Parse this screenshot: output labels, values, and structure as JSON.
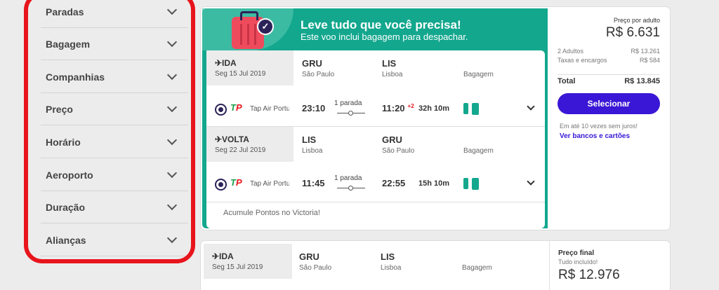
{
  "filters": {
    "items": [
      "Paradas",
      "Bagagem",
      "Companhias",
      "Preço",
      "Horário",
      "Aeroporto",
      "Duração",
      "Alianças"
    ]
  },
  "colors": {
    "accent": "#3a17d6",
    "promo": "#13a78e",
    "highlight_frame": "#e8141c"
  },
  "offer": {
    "promo_title": "Leve tudo que você precisa!",
    "promo_subtitle": "Este voo inclui bagagem para despachar.",
    "outbound": {
      "tag": "✈IDA",
      "date": "Seg 15 Jul 2019",
      "from_code": "GRU",
      "from_city": "São Paulo",
      "to_code": "LIS",
      "to_city": "Lisboa",
      "baggage_label": "Bagagem",
      "airline": "Tap Air Portugal",
      "dep": "23:10",
      "stops": "1 parada",
      "arr": "11:20",
      "plus": "+2",
      "duration": "32h 10m"
    },
    "return": {
      "tag": "✈VOLTA",
      "date": "Seg 22 Jul 2019",
      "from_code": "LIS",
      "from_city": "Lisboa",
      "to_code": "GRU",
      "to_city": "São Paulo",
      "baggage_label": "Bagagem",
      "airline": "Tap Air Portugal",
      "dep": "11:45",
      "stops": "1 parada",
      "arr": "22:55",
      "duration": "15h 10m"
    },
    "logo_a": "T",
    "logo_b": "P",
    "points": "Acumule Pontos no Victoria!",
    "price": {
      "per_adult_label": "Preço por adulto",
      "per_adult": "R$ 6.631",
      "adults_label": "2 Adultos",
      "adults_value": "R$ 13.261",
      "taxes_label": "Taxas e encargos",
      "taxes_value": "R$ 584",
      "total_label": "Total",
      "total_value": "R$ 13.845",
      "select_label": "Selecionar",
      "installments": "Em até 10 vezes sem juros!",
      "banks_link": "Ver bancos e cartões"
    }
  },
  "offer2": {
    "tag": "✈IDA",
    "date": "Seg 15 Jul 2019",
    "from_code": "GRU",
    "from_city": "São Paulo",
    "to_code": "LIS",
    "to_city": "Lisboa",
    "baggage_label": "Bagagem",
    "final_label": "Preço final",
    "included": "Tudo incluído!",
    "final_value": "R$ 12.976"
  }
}
